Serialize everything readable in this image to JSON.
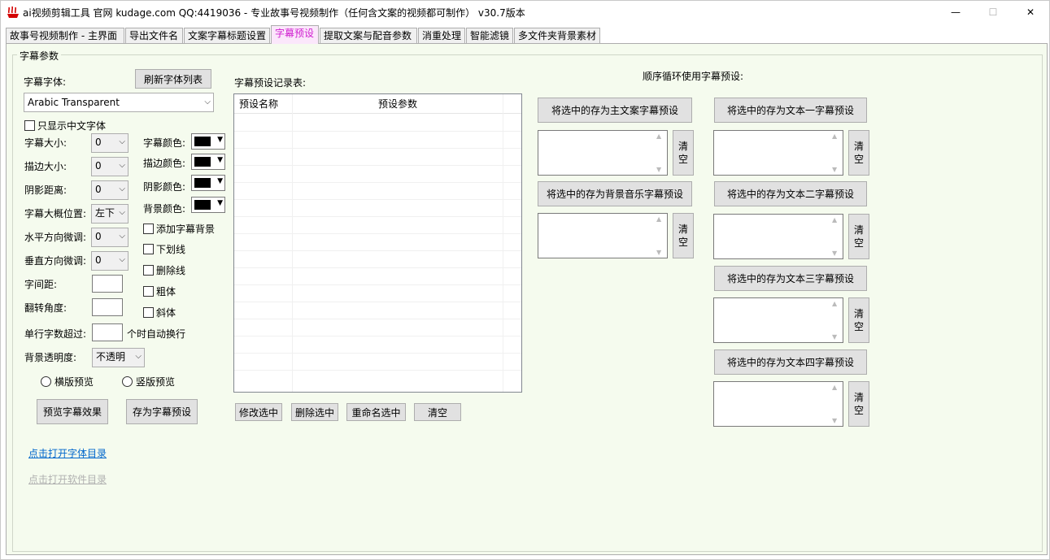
{
  "window": {
    "title": "ai视频剪辑工具 官网 kudage.com QQ:4419036 -  专业故事号视频制作（任何含文案的视频都可制作）  v30.7版本",
    "min_glyph": "—",
    "max_glyph": "☐",
    "close_glyph": "✕"
  },
  "tabs": [
    {
      "label": "故事号视频制作 - 主界面"
    },
    {
      "label": "导出文件名"
    },
    {
      "label": "文案字幕标题设置"
    },
    {
      "label": "字幕预设"
    },
    {
      "label": "提取文案与配音参数"
    },
    {
      "label": "消重处理"
    },
    {
      "label": "智能滤镜"
    },
    {
      "label": "多文件夹背景素材"
    }
  ],
  "group_title": "字幕参数",
  "left": {
    "font_label": "字幕字体:",
    "refresh_fonts": "刷新字体列表",
    "font_value": "Arabic Transparent",
    "only_chinese": "只显示中文字体",
    "size_label": "字幕大小:",
    "size_value": "0",
    "stroke_label": "描边大小:",
    "stroke_value": "0",
    "shadow_label": "阴影距离:",
    "shadow_value": "0",
    "position_label": "字幕大概位置:",
    "position_value": "左下",
    "hfine_label": "水平方向微调:",
    "hfine_value": "0",
    "vfine_label": "垂直方向微调:",
    "vfine_value": "0",
    "spacing_label": "字间距:",
    "rotate_label": "翻转角度:",
    "wrap_label": "单行字数超过:",
    "wrap_suffix": "个时自动换行",
    "opacity_label": "背景透明度:",
    "opacity_value": "不透明",
    "sub_color": "字幕颜色:",
    "stroke_color": "描边颜色:",
    "shadow_color": "阴影颜色:",
    "bg_color": "背景颜色:",
    "add_bg": "添加字幕背景",
    "underline": "下划线",
    "strike": "删除线",
    "bold": "粗体",
    "italic": "斜体",
    "landscape": "横版预览",
    "portrait": "竖版预览",
    "preview_btn": "预览字幕效果",
    "save_btn": "存为字幕预设",
    "open_fonts": "点击打开字体目录",
    "open_app": "点击打开软件目录"
  },
  "records": {
    "title": "字幕预设记录表:",
    "col_name": "预设名称",
    "col_params": "预设参数",
    "modify": "修改选中",
    "delete": "删除选中",
    "rename": "重命名选中",
    "clear": "清空"
  },
  "cycle": {
    "title": "顺序循环使用字幕预设:",
    "main_btn": "将选中的存为主文案字幕预设",
    "bgm_btn": "将选中的存为背景音乐字幕预设",
    "t1_btn": "将选中的存为文本一字幕预设",
    "t2_btn": "将选中的存为文本二字幕预设",
    "t3_btn": "将选中的存为文本三字幕预设",
    "t4_btn": "将选中的存为文本四字幕预设",
    "clear_top": "清",
    "clear_bottom": "空"
  }
}
